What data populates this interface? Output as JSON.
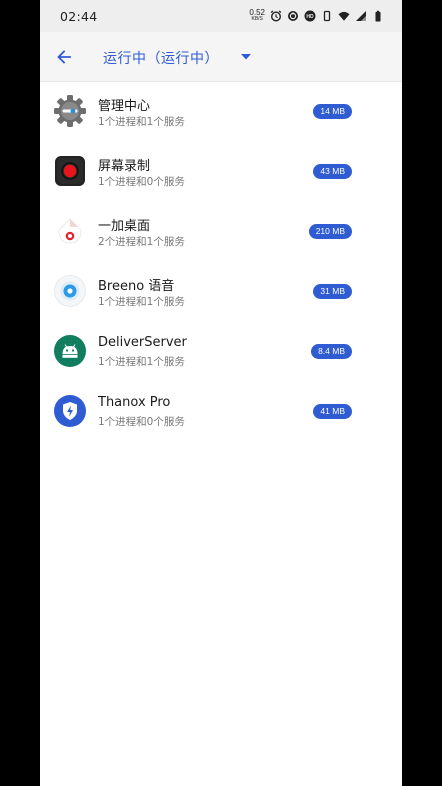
{
  "status_bar": {
    "time": "02:44",
    "net_speed": "0.52",
    "net_unit": "KB/S",
    "icons": [
      "alarm-icon",
      "sync-icon",
      "hd-icon",
      "vibrate-icon",
      "wifi-icon",
      "signal-icon",
      "battery-icon"
    ]
  },
  "toolbar": {
    "title": "运行中（运行中）",
    "back_icon": "arrow-back-icon",
    "dropdown_icon": "dropdown-arrow-icon"
  },
  "colors": {
    "accent": "#2f5bd3",
    "status_bar_bg": "#eeeeee",
    "toolbar_bg": "#f5f5f5"
  },
  "apps": [
    {
      "name": "管理中心",
      "sub": "1个进程和1个服务",
      "size": "14 MB",
      "icon": "settings-gear-icon"
    },
    {
      "name": "屏幕录制",
      "sub": "1个进程和0个服务",
      "size": "43 MB",
      "icon": "screen-record-icon"
    },
    {
      "name": "一加桌面",
      "sub": "2个进程和1个服务",
      "size": "210 MB",
      "icon": "launcher-icon"
    },
    {
      "name": "Breeno 语音",
      "sub": "1个进程和1个服务",
      "size": "31 MB",
      "icon": "breeno-voice-icon"
    },
    {
      "name": "DeliverServer",
      "sub": "1个进程和1个服务",
      "size": "8.4 MB",
      "icon": "android-robot-icon"
    },
    {
      "name": "Thanox Pro",
      "sub": "1个进程和0个服务",
      "size": "41 MB",
      "icon": "thanox-shield-icon"
    }
  ]
}
